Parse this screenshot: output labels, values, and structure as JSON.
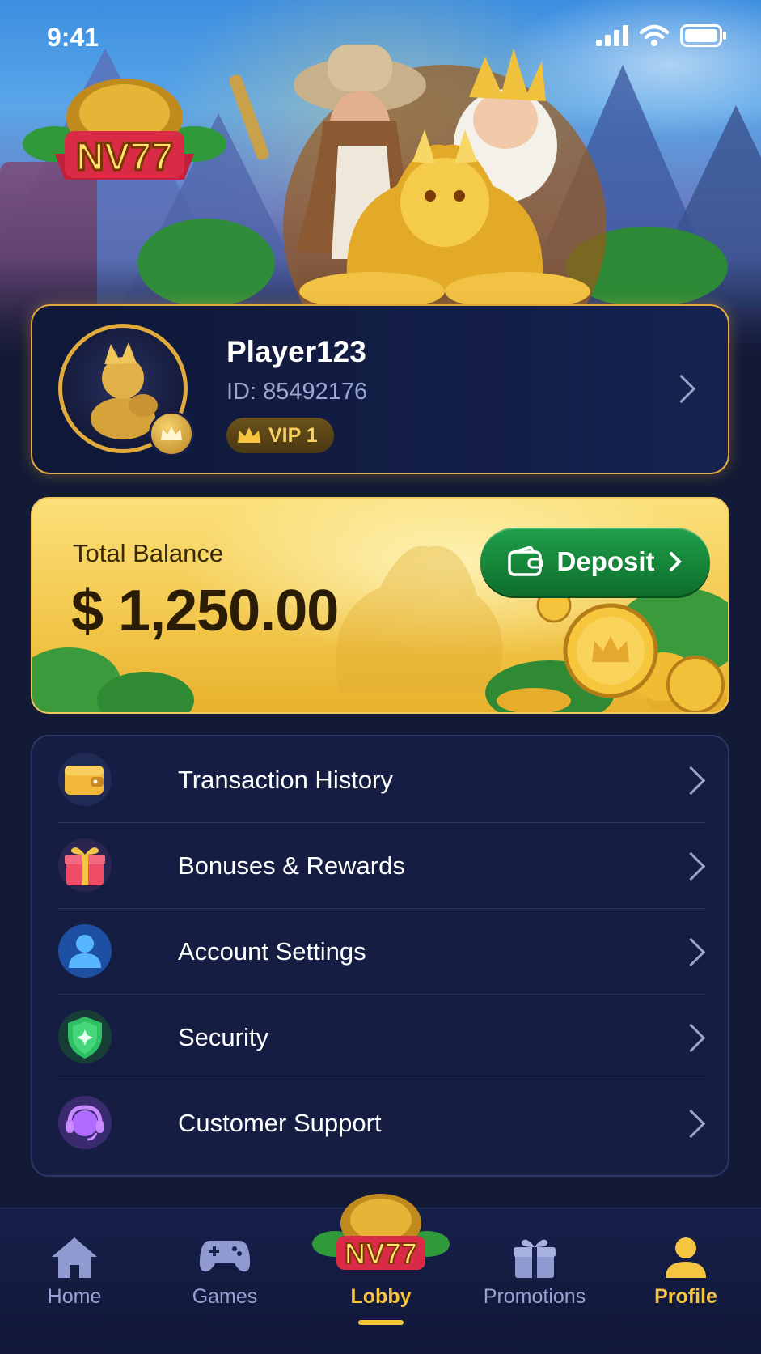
{
  "status_bar": {
    "time": "9:41"
  },
  "brand": {
    "logo_text": "NV77"
  },
  "profile": {
    "name": "Player123",
    "id_text": "ID: 85492176",
    "vip_label": "VIP 1"
  },
  "balance": {
    "label": "Total Balance",
    "amount": "$ 1,250.00",
    "deposit_label": "Deposit"
  },
  "menu": {
    "items": [
      {
        "label": "Transaction History",
        "icon": "wallet-icon"
      },
      {
        "label": "Bonuses & Rewards",
        "icon": "gift-icon"
      },
      {
        "label": "Account Settings",
        "icon": "user-icon"
      },
      {
        "label": "Security",
        "icon": "shield-icon"
      },
      {
        "label": "Customer Support",
        "icon": "headset-icon"
      }
    ]
  },
  "nav": {
    "items": [
      {
        "label": "Home",
        "icon": "home-icon"
      },
      {
        "label": "Games",
        "icon": "gamepad-icon"
      },
      {
        "label": "Lobby",
        "icon": "nv77-logo-icon"
      },
      {
        "label": "Promotions",
        "icon": "gift-icon"
      },
      {
        "label": "Profile",
        "icon": "user-icon"
      }
    ],
    "active": "Profile"
  },
  "colors": {
    "accent_gold": "#f5c542",
    "deposit_green": "#1fa04a",
    "background": "#121a35"
  }
}
